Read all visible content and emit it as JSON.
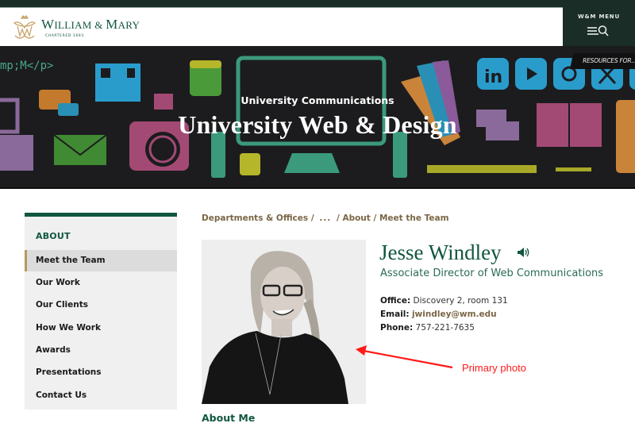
{
  "header": {
    "logo_icon": "wm-cypher-icon",
    "brand_name_part1": "W",
    "brand_name_part2": "ILLIAM & ",
    "brand_name_part3": "M",
    "brand_name_part4": "ARY",
    "brand_sub": "CHARTERED 1693",
    "menu_label": "W&M MENU",
    "menu_icon": "menu-search-icon"
  },
  "banner": {
    "code_snippet": "mp;M</p>",
    "resources_label": "RESOURCES FOR...",
    "kicker": "University Communications",
    "title": "University Web & Design"
  },
  "sidebar": {
    "heading": "ABOUT",
    "items": [
      {
        "label": "Meet the Team",
        "active": true
      },
      {
        "label": "Our Work"
      },
      {
        "label": "Our Clients"
      },
      {
        "label": "How We Work"
      },
      {
        "label": "Awards"
      },
      {
        "label": "Presentations"
      },
      {
        "label": "Contact Us"
      }
    ]
  },
  "breadcrumb": {
    "items": [
      "Departments & Offices",
      "...",
      "About",
      "Meet the Team"
    ],
    "separator": "/"
  },
  "profile": {
    "name": "Jesse Windley",
    "speaker_icon": "speaker-icon",
    "job_title": "Associate Director of Web Communications",
    "office_label": "Office:",
    "office_value": "Discovery 2, room 131",
    "email_label": "Email:",
    "email_value": "jwindley@wm.edu",
    "phone_label": "Phone:",
    "phone_value": "757-221-7635",
    "about_heading": "About Me"
  },
  "annotation": {
    "label": "Primary photo",
    "color": "#ff1a1a"
  },
  "colors": {
    "brand_green": "#115740",
    "gold": "#b9975b",
    "dark_bar": "#1a2e27"
  }
}
